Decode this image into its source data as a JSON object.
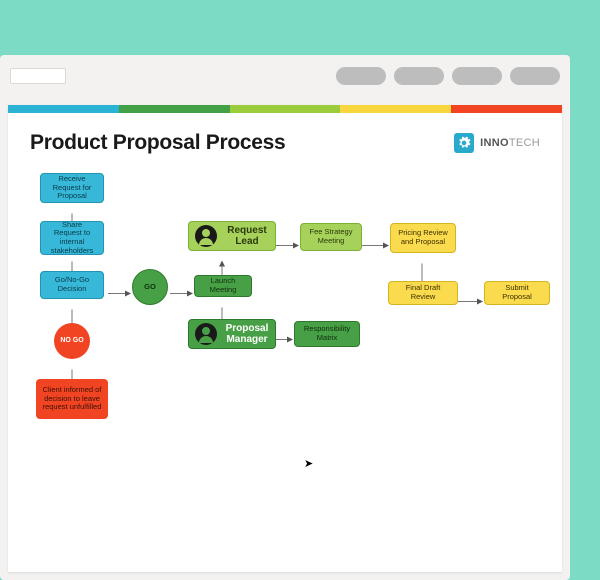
{
  "title": "Product Proposal Process",
  "logo": {
    "brand_a": "INNO",
    "brand_b": "TECH"
  },
  "nodes": {
    "receive": "Receive Request for Proposal",
    "share": "Share Request to internal stakeholders",
    "decision": "Go/No-Go Decision",
    "go": "GO",
    "nogo": "NO GO",
    "client": "Client informed of decision to leave request unfulfilled",
    "launch": "Launch Meeting",
    "req_lead": "Request Lead",
    "prop_mgr": "Proposal Manager",
    "resp_matrix": "Responsibility Matrix",
    "fee": "Fee Strategy Meeting",
    "pricing": "Pricing Review and Proposal",
    "final": "Final Draft Review",
    "submit": "Submit Proposal"
  }
}
